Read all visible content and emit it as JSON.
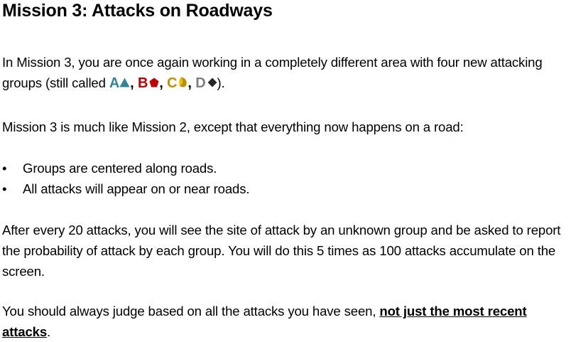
{
  "title": "Mission 3: Attacks on Roadways",
  "colors": {
    "group_a": "#31849b",
    "group_b": "#c00000",
    "group_c": "#bf8f00",
    "group_d": "#7f7f7f",
    "symbol_d": "#262626",
    "text": "#000000"
  },
  "intro": {
    "text_before": "In Mission 3, you are once again working in a completely different area with four new attacking groups (still called ",
    "groups": [
      {
        "letter": "A",
        "icon": "triangle-icon"
      },
      {
        "letter": "B",
        "icon": "pentagon-icon"
      },
      {
        "letter": "C",
        "icon": "crescent-icon"
      },
      {
        "letter": "D",
        "icon": "diamond-icon"
      }
    ],
    "sep": ", ",
    "text_after": ")."
  },
  "comparison": "Mission 3 is much like Mission 2, except that everything now happens on a road:",
  "bullet_char": "•",
  "bullets": [
    "Groups are centered along roads.",
    "All attacks will appear on or near roads."
  ],
  "reporting": "After every 20 attacks, you will see the site of attack by an unknown group and be asked to report the probability of attack by each group. You will do this 5 times as 100 attacks accumulate on the screen.",
  "closing": {
    "text_before": "You should always judge based on all the attacks you have seen, ",
    "emphasis": "not just the most recent attacks",
    "text_after": "."
  }
}
